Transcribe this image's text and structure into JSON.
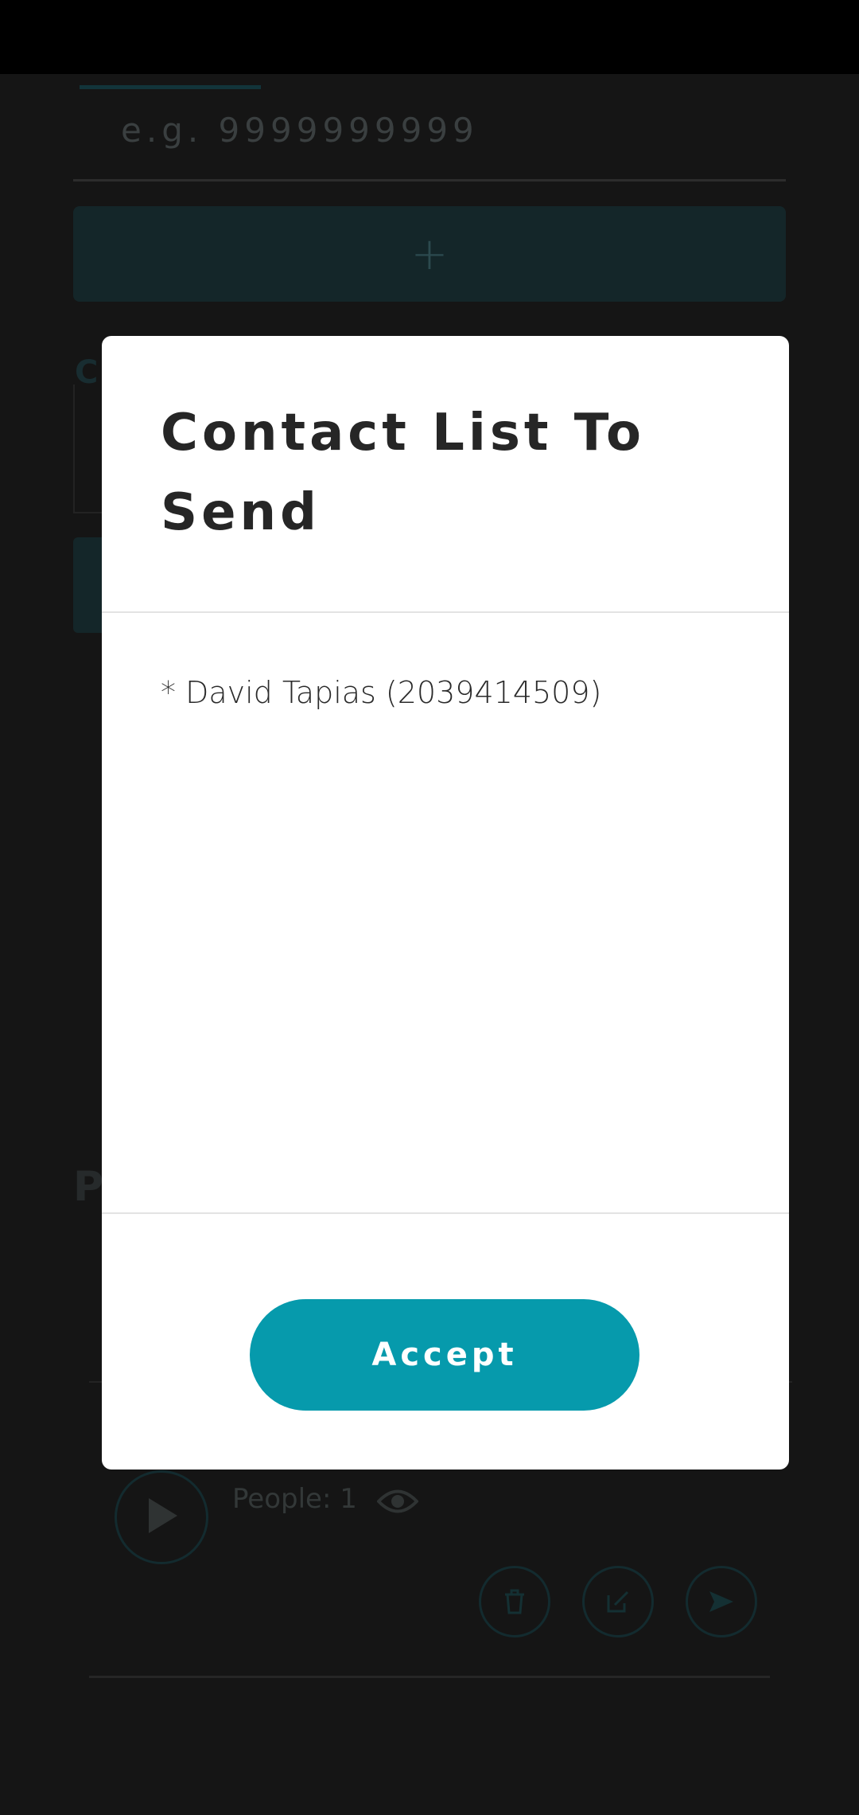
{
  "background": {
    "phone_placeholder": "e.g. 9999999999",
    "add_button_symbol": "+",
    "section_initial_c": "C",
    "section_initial_p": "P",
    "people_count_label": "People: 1",
    "icons": [
      "plus-icon",
      "play-icon",
      "eye-icon",
      "trash-icon",
      "edit-icon",
      "send-icon"
    ]
  },
  "modal": {
    "title": "Contact List To Send",
    "contacts": [
      "* David Tapias (2039414509)"
    ],
    "accept_label": "Accept"
  },
  "colors": {
    "accent": "#069aac",
    "backdrop": "#141414",
    "modal_bg": "#ffffff",
    "title_text": "#262626"
  }
}
